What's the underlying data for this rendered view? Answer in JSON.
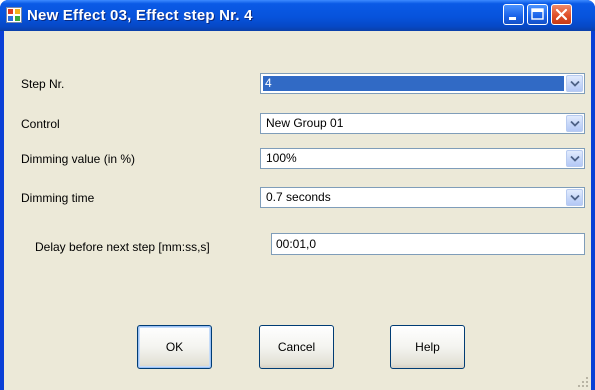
{
  "window": {
    "title": "New Effect 03, Effect step Nr. 4",
    "accent_color": "#0a5ae6",
    "close_color": "#e0502a"
  },
  "form": {
    "step": {
      "label": "Step Nr.",
      "value": "4"
    },
    "control": {
      "label": "Control",
      "value": "New Group 01"
    },
    "dimming_value": {
      "label": "Dimming value (in %)",
      "value": "100%"
    },
    "dimming_time": {
      "label": "Dimming time",
      "value": "0.7 seconds"
    },
    "delay": {
      "label": "Delay before next step [mm:ss,s]",
      "value": "00:01,0"
    }
  },
  "buttons": {
    "ok": "OK",
    "cancel": "Cancel",
    "help": "Help"
  },
  "icons": {
    "app": "app-icon",
    "minimize": "minimize-icon",
    "maximize": "maximize-icon",
    "close": "close-icon",
    "dropdown": "chevron-down-icon",
    "grip": "resize-grip-icon"
  }
}
